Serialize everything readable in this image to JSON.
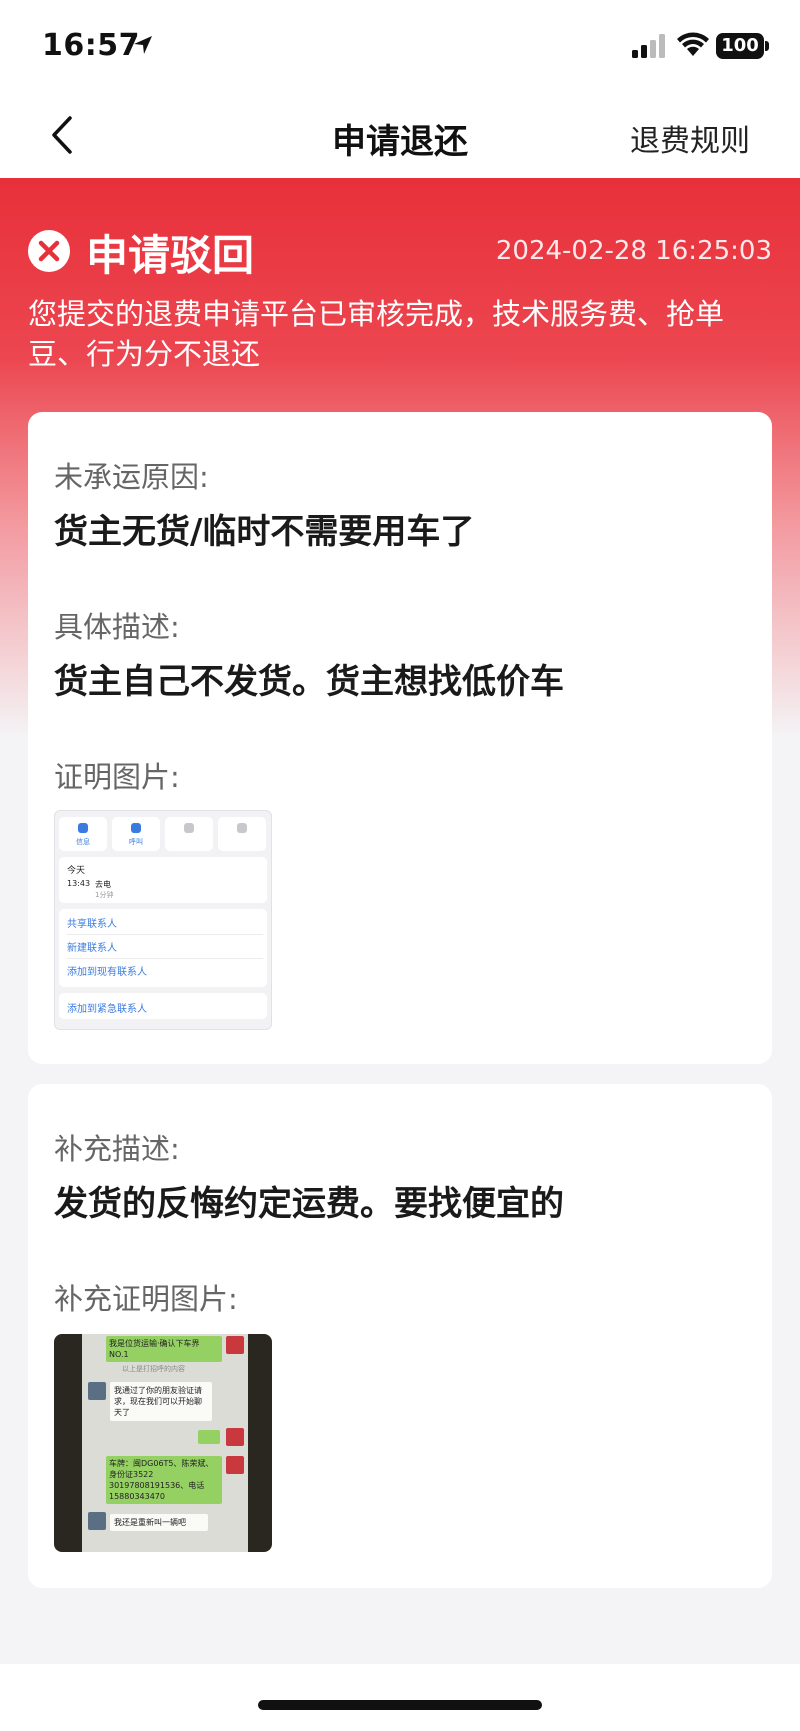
{
  "status_bar": {
    "time": "16:57",
    "battery": "100"
  },
  "nav": {
    "title": "申请退还",
    "right_action": "退费规则"
  },
  "banner": {
    "status_title": "申请驳回",
    "timestamp": "2024-02-28 16:25:03",
    "description": "您提交的退费申请平台已审核完成，技术服务费、抢单豆、行为分不退还"
  },
  "card1": {
    "reason_label": "未承运原因:",
    "reason_value": "货主无货/临时不需要用车了",
    "detail_label": "具体描述:",
    "detail_value": "货主自己不发货。货主想找低价车",
    "proof_label": "证明图片:",
    "proof_image": {
      "btn_labels": [
        "信息",
        "呼叫",
        "",
        ""
      ],
      "today": "今天",
      "call_time": "13:43",
      "call_type": "去电",
      "call_len": "1分钟",
      "links": [
        "共享联系人",
        "新建联系人",
        "添加到现有联系人",
        "添加到紧急联系人"
      ]
    }
  },
  "card2": {
    "supp_label": "补充描述:",
    "supp_value": "发货的反悔约定运费。要找便宜的",
    "supp_proof_label": "补充证明图片:",
    "supp_image": {
      "top_msg": "我是位货运输·确认下车界NO.1",
      "system_note": "以上是打招呼的内容",
      "friend_msg": "我通过了你的朋友验证请求，现在我们可以开始聊天了",
      "info_msg": "车牌：闽DG06T5、陈荣斌、身份证3522 30197808191536、电话15880343470",
      "last_msg": "我还是重新叫一辆吧"
    }
  },
  "colors": {
    "accent": "#e8303a",
    "link": "#3a7be0"
  }
}
